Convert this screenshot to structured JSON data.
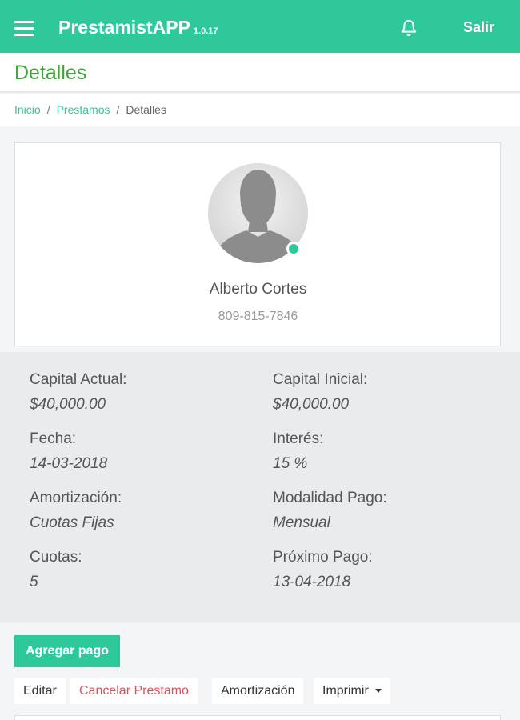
{
  "app": {
    "name": "PrestamistAPP",
    "version": "1.0.17",
    "logout_label": "Salir"
  },
  "page": {
    "title": "Detalles"
  },
  "breadcrumb": {
    "home": "Inicio",
    "section": "Prestamos",
    "current": "Detalles",
    "separator": "/"
  },
  "client": {
    "name": "Alberto Cortes",
    "phone": "809-815-7846",
    "status": "online"
  },
  "loan": {
    "capital_actual": {
      "label": "Capital Actual:",
      "value": "$40,000.00"
    },
    "capital_inicial": {
      "label": "Capital Inicial:",
      "value": "$40,000.00"
    },
    "fecha": {
      "label": "Fecha:",
      "value": "14-03-2018"
    },
    "interes": {
      "label": "Interés:",
      "value": "15 %"
    },
    "amortizacion": {
      "label": "Amortización:",
      "value": "Cuotas Fijas"
    },
    "modalidad": {
      "label": "Modalidad Pago:",
      "value": "Mensual"
    },
    "cuotas": {
      "label": "Cuotas:",
      "value": "5"
    },
    "proximo_pago": {
      "label": "Próximo Pago:",
      "value": "13-04-2018"
    }
  },
  "actions": {
    "add_payment": "Agregar pago",
    "edit": "Editar",
    "cancel_loan": "Cancelar Prestamo",
    "amortization": "Amortización",
    "print": "Imprimir"
  },
  "icons": {
    "menu": "hamburger-icon",
    "notifications": "bell-icon",
    "avatar": "user-silhouette",
    "print_dropdown": "caret-down-icon"
  },
  "colors": {
    "brand": "#2ec89a",
    "title": "#3fa53a",
    "danger": "#e0505a",
    "panel": "#e9ebed"
  }
}
